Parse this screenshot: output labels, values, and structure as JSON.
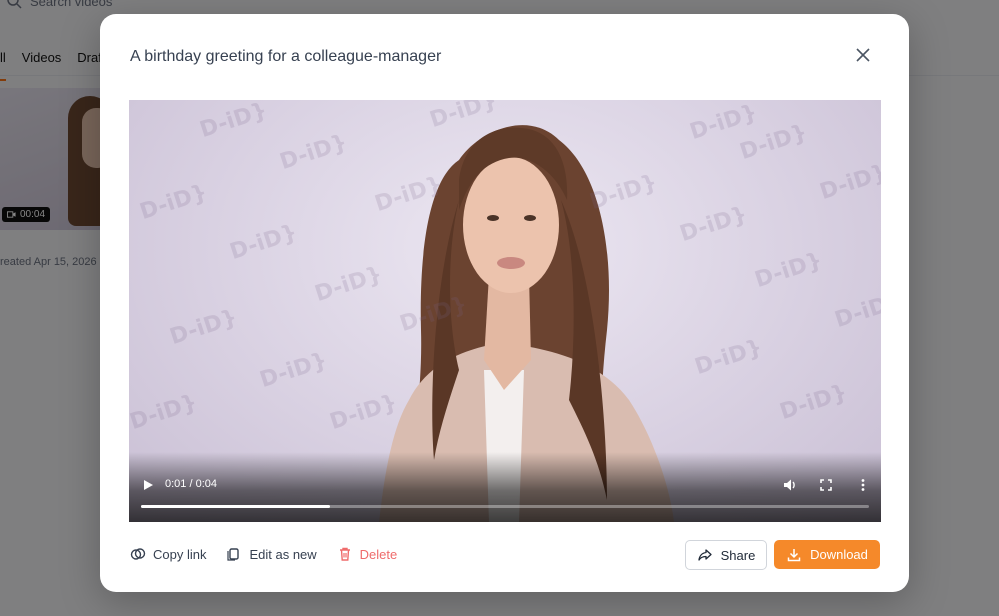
{
  "background": {
    "search_placeholder": "Search videos",
    "tabs": [
      "ll",
      "Videos",
      "Draf"
    ],
    "thumbnail": {
      "duration": "00:04",
      "created": "reated Apr 15, 2026"
    }
  },
  "modal": {
    "title": "A birthday greeting for a colleague-manager",
    "watermark": "D-iD}",
    "player": {
      "time": "0:01 / 0:04",
      "progress_fraction": 0.26
    },
    "actions": {
      "copy_link": "Copy link",
      "edit_as_new": "Edit as new",
      "delete": "Delete",
      "share": "Share",
      "download": "Download"
    }
  },
  "colors": {
    "accent": "#f5892a",
    "danger": "#ef6b6b"
  }
}
